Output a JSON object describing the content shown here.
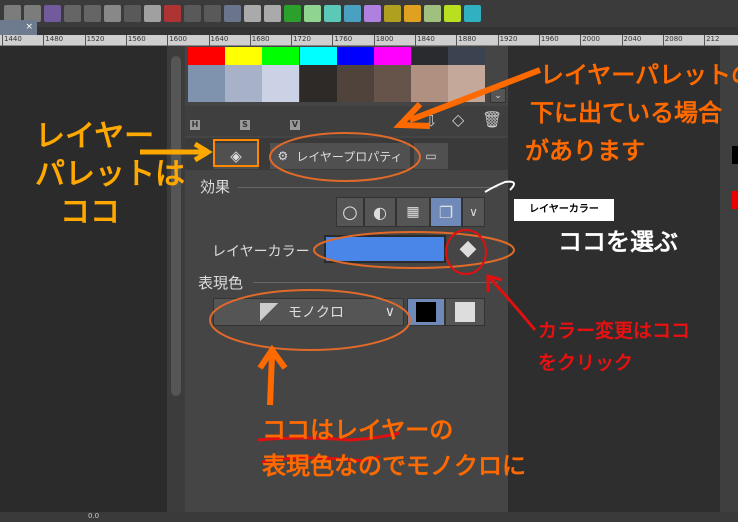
{
  "toolbar": {
    "icons": [
      "new-file-icon",
      "open-file-icon",
      "save-icon",
      "undo-icon",
      "redo-icon",
      "loading-icon",
      "clear-icon",
      "fill-icon",
      "red-box-icon",
      "transform-icon",
      "select-icon",
      "check-icon",
      "hat-icon",
      "help-icon",
      "pen-green-icon",
      "pen-lightgreen-icon",
      "pen-cyan-icon",
      "ink-icon",
      "purple-brush-icon",
      "yellow-icon",
      "orange-icon",
      "spiral-icon",
      "lime-icon",
      "teal-icon"
    ]
  },
  "document_tab": {
    "close": "×"
  },
  "ruler": {
    "labels": [
      "1440",
      "1480",
      "1520",
      "1560",
      "1600",
      "1640",
      "1680",
      "1720",
      "1760",
      "1800",
      "1840",
      "1880",
      "1920",
      "1960",
      "2000",
      "2040",
      "2080",
      "212"
    ]
  },
  "palette": {
    "row1": [
      "#ff0000",
      "#ffff00",
      "#00ff00",
      "#00ffff",
      "#0000ff",
      "#ff00ff",
      "#2a2b2e",
      "#3c4350"
    ],
    "row2": [
      "#7f92ae",
      "#a7b2c8",
      "#ccd2e6",
      "#2e2a27",
      "#4f433b",
      "#66544a",
      "#b09080",
      "#c4a89a"
    ]
  },
  "panel": {
    "hsv": [
      "H",
      "S",
      "V"
    ],
    "tab_label": "レイヤープロパティ",
    "effect_label": "効果",
    "layer_color_label": "レイヤーカラー",
    "layer_color": "#4a86e8",
    "expression_label": "表現色",
    "expression_value": "モノクロ",
    "tooltip": "レイヤーカラー"
  },
  "status": {
    "value": "0.0"
  },
  "annotations": {
    "layer_palette": [
      "レイヤー",
      "パレットは",
      "ココ"
    ],
    "below_palette": [
      "レイヤーパレットの",
      "下に出ている場合",
      "があります"
    ],
    "select_here": "ココを選ぶ",
    "click_here": [
      "カラー変更はココ",
      "をクリック"
    ],
    "monochrome": [
      "ココはレイヤーの",
      "表現色なのでモノクロに"
    ],
    "orange": "#ff6a00",
    "yellow": "#ffa800",
    "red": "#e81010"
  }
}
